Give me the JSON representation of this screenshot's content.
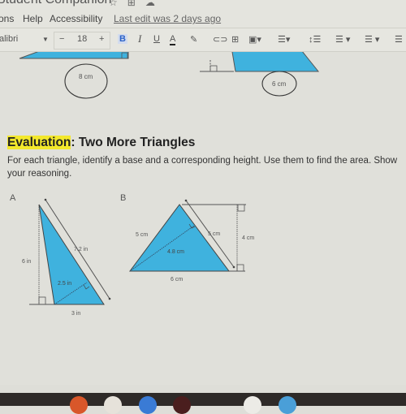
{
  "window": {
    "title": "Student Companion",
    "title_icons": [
      "star-icon",
      "move-to-folder-icon",
      "cloud-status-icon"
    ]
  },
  "menubar": {
    "items": [
      "ons",
      "Help",
      "Accessibility"
    ],
    "last_edit": "Last edit was 2 days ago"
  },
  "toolbar": {
    "font": "alibri",
    "font_size": "18",
    "decrease_label": "−",
    "increase_label": "+",
    "bold": "B",
    "italic": "I",
    "underline": "U",
    "text_color": "A",
    "icons": [
      "highlighter-icon",
      "link-icon",
      "comment-icon",
      "image-icon",
      "align-icon",
      "line-spacing-icon",
      "numbered-list-icon",
      "bulleted-list-icon",
      "indent-icon"
    ]
  },
  "top_figures": {
    "left_label": "8 cm",
    "right_label": "6 cm"
  },
  "section": {
    "heading_highlight": "Evaluation",
    "heading_rest": ": Two More Triangles",
    "instructions": "For each triangle, identify a base and a corresponding height. Use them to find the area. Show your reasoning."
  },
  "triangle_a": {
    "label": "A",
    "height": "6 in",
    "side": "7.2 in",
    "inner_height": "2.5 in",
    "base": "3 in"
  },
  "triangle_b": {
    "label": "B",
    "left_side": "5 cm",
    "right_side": "5 cm",
    "inner_height": "4.8 cm",
    "outer_height": "4 cm",
    "base": "6 cm"
  },
  "colors": {
    "shape_fill": "#3fb2de",
    "highlight": "#f3e82c",
    "bold_active": "#2a62c9"
  }
}
